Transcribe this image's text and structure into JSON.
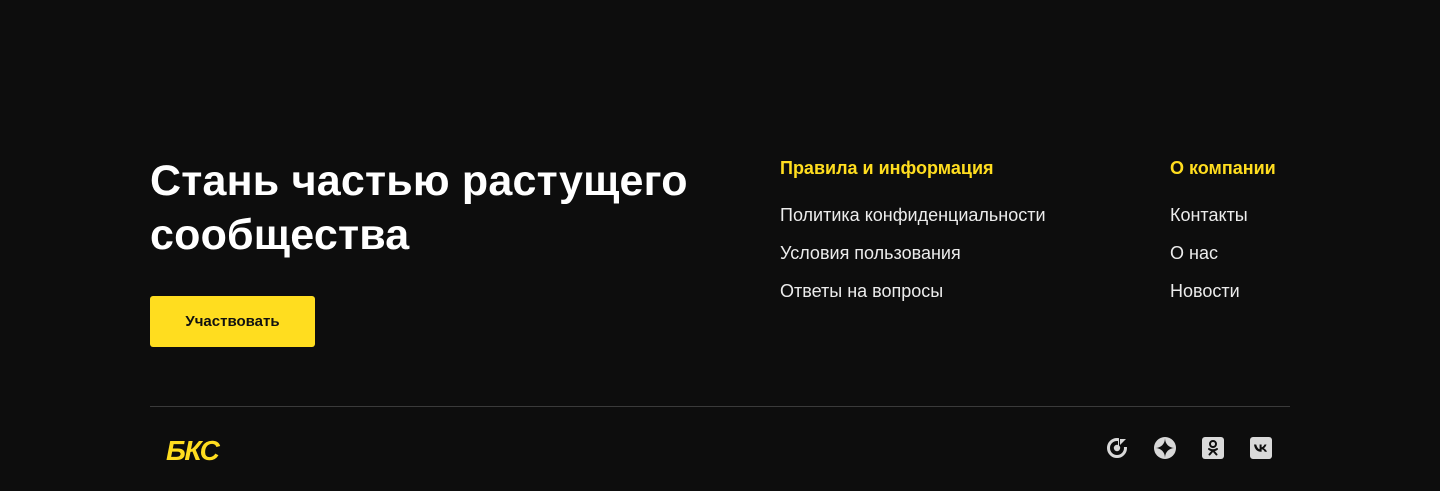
{
  "cta": {
    "title_line1": "Стань частью растущего",
    "title_line2": "сообщества",
    "button_label": "Участвовать"
  },
  "columns": {
    "rules": {
      "heading": "Правила и информация",
      "links": [
        "Политика конфиденциальности",
        "Условия пользования",
        "Ответы на вопросы"
      ]
    },
    "company": {
      "heading": "О компании",
      "links": [
        "Контакты",
        "О нас",
        "Новости"
      ]
    }
  },
  "logo": {
    "text": "БКС",
    "color": "#ffdd1f"
  },
  "socials": [
    "dzen-icon",
    "compass-icon",
    "odnoklassniki-icon",
    "vk-icon"
  ],
  "colors": {
    "background": "#0d0d0d",
    "accent": "#ffdd1f",
    "text": "#ffffff",
    "divider": "#3a3a3a"
  }
}
